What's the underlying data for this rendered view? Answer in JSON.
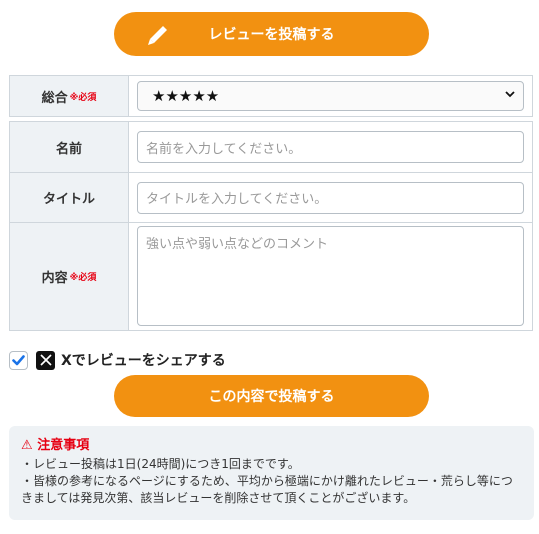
{
  "review_button": {
    "label": "レビューを投稿する",
    "icon": "pencil-icon"
  },
  "form": {
    "overall": {
      "label": "総合",
      "required": "※必須",
      "selected": "★★★★★"
    },
    "name": {
      "label": "名前",
      "placeholder": "名前を入力してください。"
    },
    "title": {
      "label": "タイトル",
      "placeholder": "タイトルを入力してください。"
    },
    "content": {
      "label": "内容",
      "required": "※必須",
      "placeholder": "強い点や弱い点などのコメント"
    }
  },
  "share": {
    "label": "Xでレビューをシェアする",
    "checked": true,
    "icon": "x-logo-icon"
  },
  "submit_button": {
    "label": "この内容で投稿する"
  },
  "notice": {
    "title": "注意事項",
    "line1": "・レビュー投稿は1日(24時間)につき1回までです。",
    "line2": "・皆様の参考になるページにするため、平均から極端にかけ離れたレビュー・荒らし等につきましては発見次第、該当レビューを削除させて頂くことがございます。"
  },
  "colors": {
    "accent": "#f29111",
    "required": "#e60012",
    "label_bg": "#eef2f5"
  }
}
